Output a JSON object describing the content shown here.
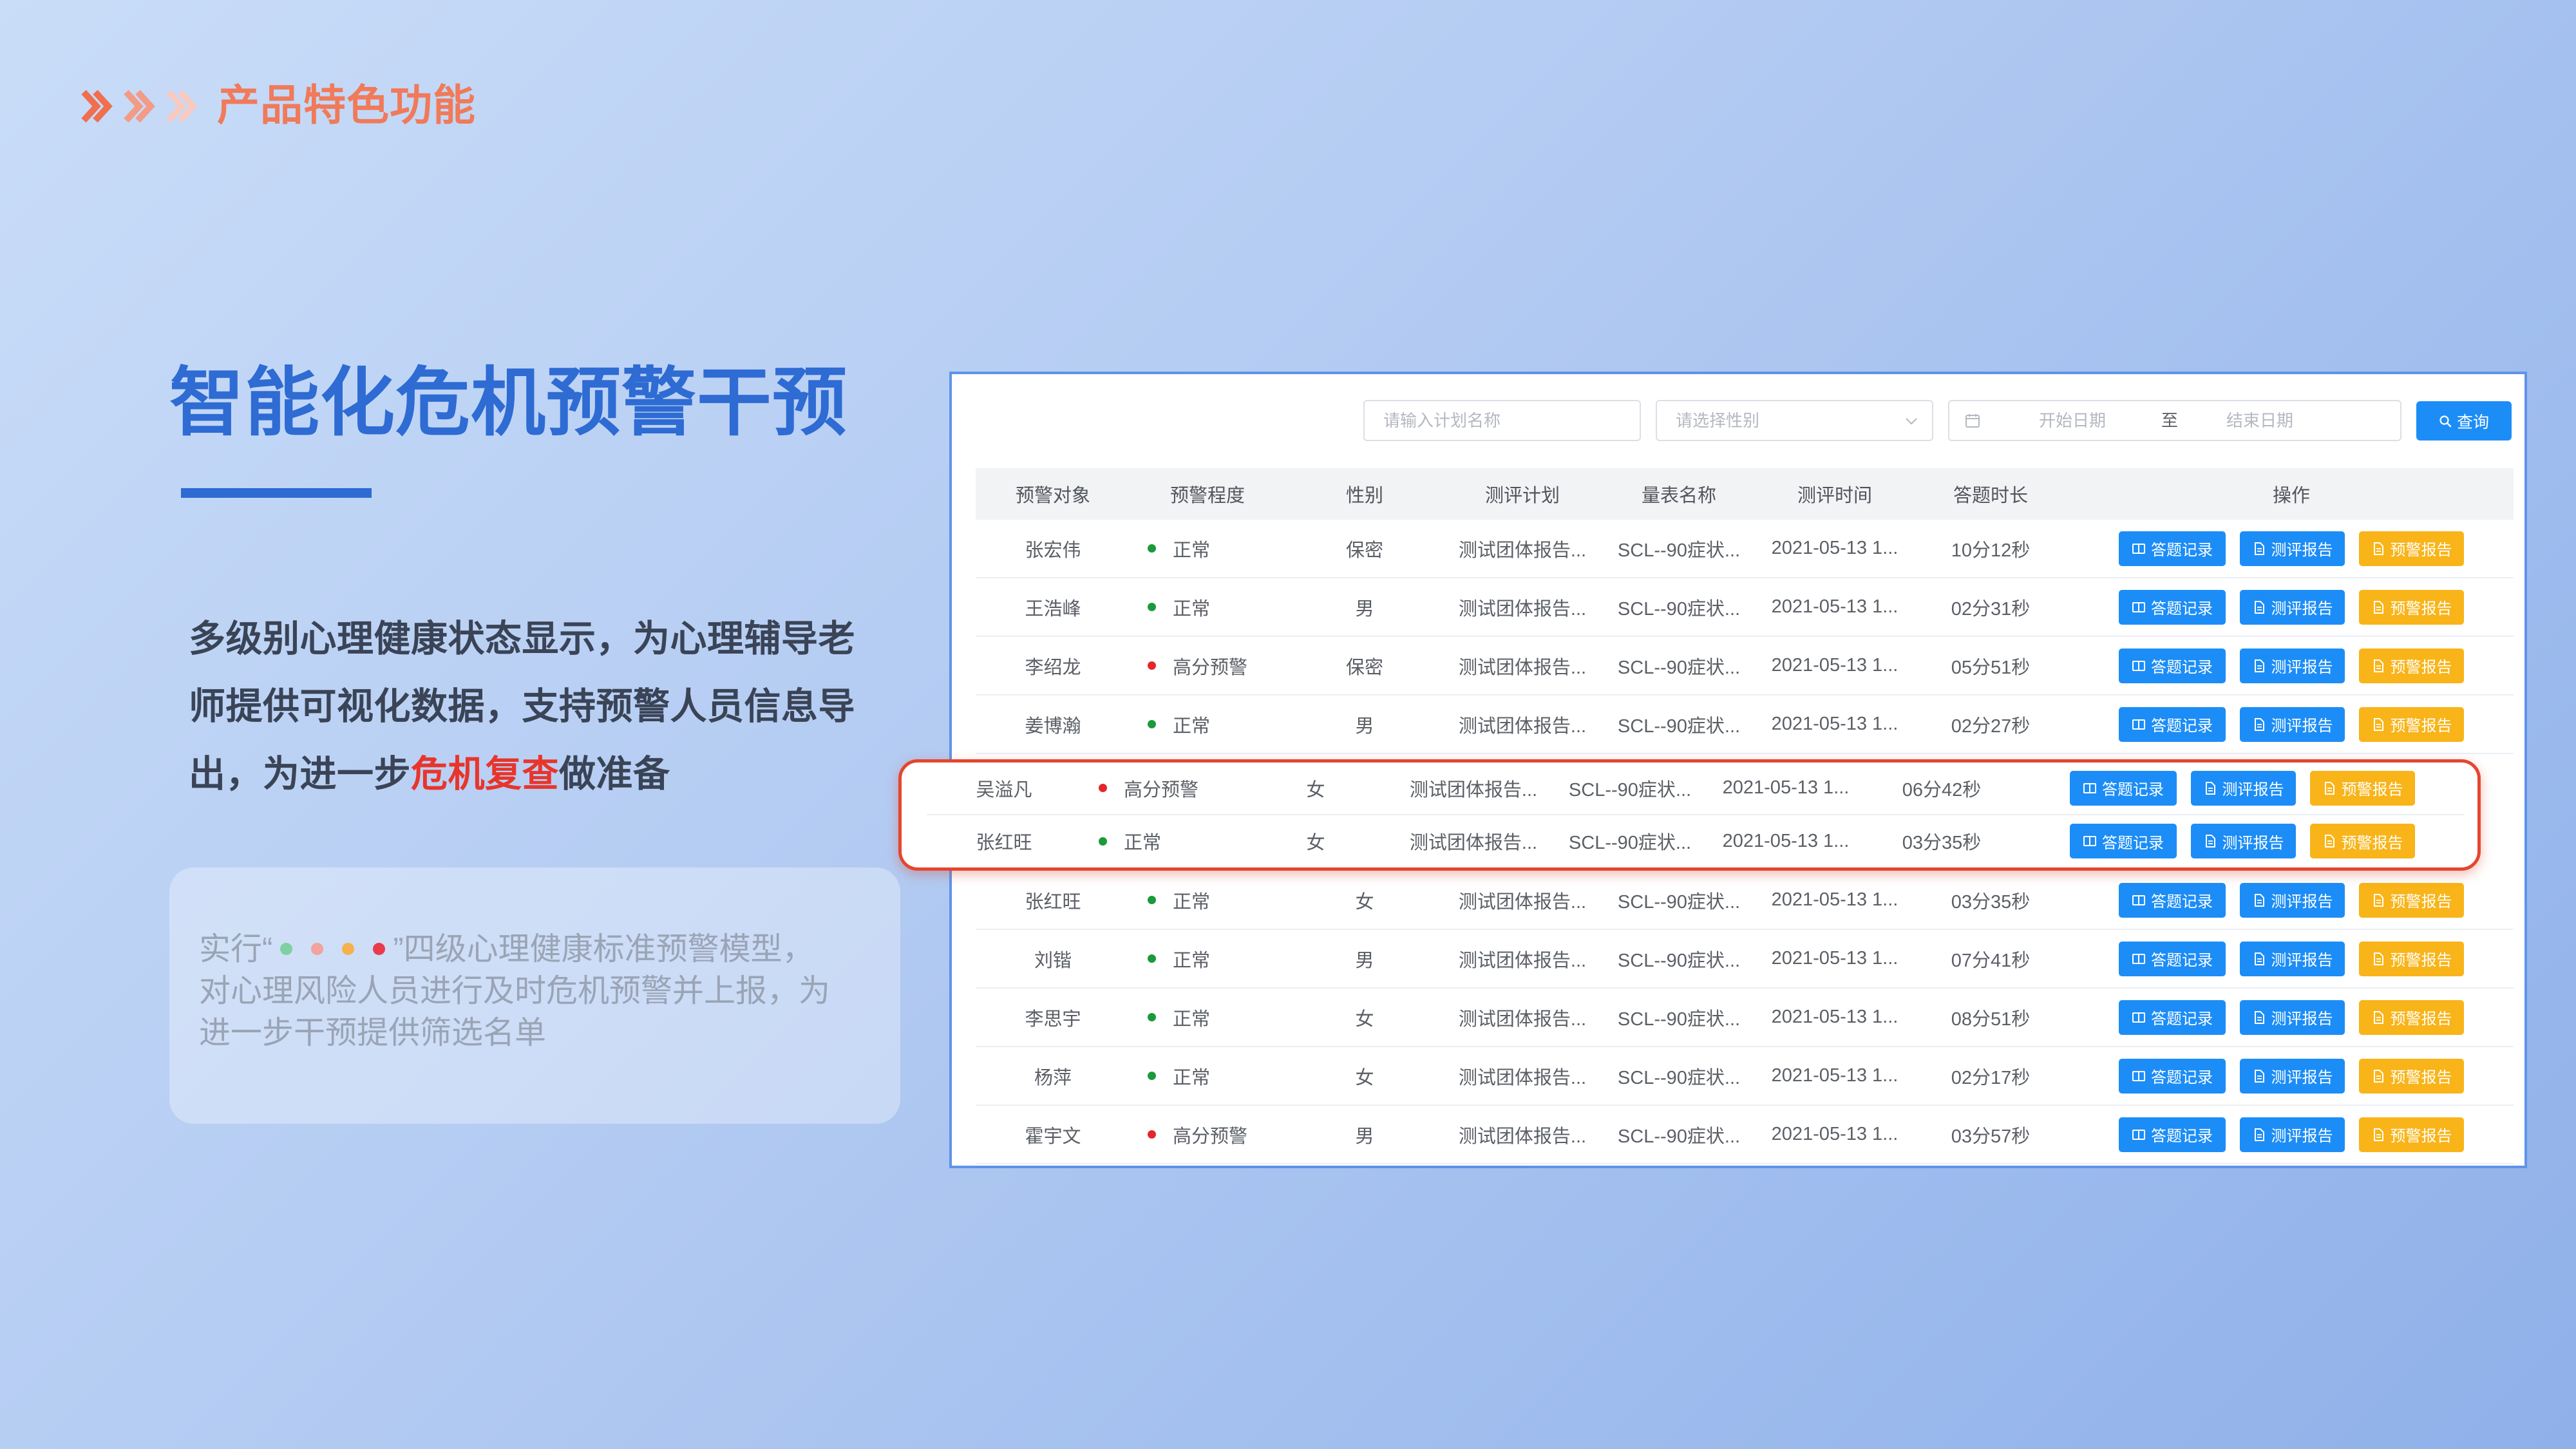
{
  "colors": {
    "accent": "#f07a5a",
    "title": "#2e6bd3",
    "highlight": "#e8352b",
    "primary": "#1c8df7",
    "warning": "#f8b418",
    "alert_border": "#e5462f"
  },
  "slide": {
    "section_title": "产品特色功能",
    "title": "智能化危机预警干预",
    "description": {
      "lines": [
        "多级别心理健康状态显示，为心理辅导老",
        "师提供可视化数据，支持预警人员信息导"
      ],
      "last_line_prefix": "出，为进一步",
      "last_line_highlight": "危机复查",
      "last_line_suffix": "做准备"
    },
    "note": {
      "line1_prefix": "实行“",
      "line1_suffix": "”四级心理健康标准预警模型，",
      "lines": [
        "对心理风险人员进行及时危机预警并上报，为",
        "进一步干预提供筛选名单"
      ],
      "level_colors": [
        "#7fd0a2",
        "#f1a39c",
        "#f5b14c",
        "#e93b4b"
      ]
    }
  },
  "app": {
    "search": {
      "plan_placeholder": "请输入计划名称",
      "gender_placeholder": "请选择性别",
      "start_placeholder": "开始日期",
      "range_separator": "至",
      "end_placeholder": "结束日期",
      "query_label": "查询"
    },
    "columns": [
      "预警对象",
      "预警程度",
      "性别",
      "测评计划",
      "量表名称",
      "测评时间",
      "答题时长",
      "操作"
    ],
    "actions": {
      "answer_record": "答题记录",
      "assessment_report": "测评报告",
      "warning_report": "预警报告"
    },
    "status_colors": {
      "正常": "#1a9a3a",
      "高分预警": "#e5262a"
    },
    "rows_top": [
      {
        "name": "张宏伟",
        "level": "正常",
        "gender": "保密",
        "plan": "测试团体报告...",
        "scale": "SCL--90症状...",
        "time": "2021-05-13 1...",
        "duration": "10分12秒"
      },
      {
        "name": "王浩峰",
        "level": "正常",
        "gender": "男",
        "plan": "测试团体报告...",
        "scale": "SCL--90症状...",
        "time": "2021-05-13 1...",
        "duration": "02分31秒"
      },
      {
        "name": "李绍龙",
        "level": "高分预警",
        "gender": "保密",
        "plan": "测试团体报告...",
        "scale": "SCL--90症状...",
        "time": "2021-05-13 1...",
        "duration": "05分51秒"
      },
      {
        "name": "姜博瀚",
        "level": "正常",
        "gender": "男",
        "plan": "测试团体报告...",
        "scale": "SCL--90症状...",
        "time": "2021-05-13 1...",
        "duration": "02分27秒"
      }
    ],
    "highlight_rows": [
      {
        "name": "吴溢凡",
        "level": "高分预警",
        "gender": "女",
        "plan": "测试团体报告...",
        "scale": "SCL--90症状...",
        "time": "2021-05-13 1...",
        "duration": "06分42秒"
      },
      {
        "name": "张红旺",
        "level": "正常",
        "gender": "女",
        "plan": "测试团体报告...",
        "scale": "SCL--90症状...",
        "time": "2021-05-13 1...",
        "duration": "03分35秒"
      }
    ],
    "rows_bottom": [
      {
        "name": "张红旺",
        "level": "正常",
        "gender": "女",
        "plan": "测试团体报告...",
        "scale": "SCL--90症状...",
        "time": "2021-05-13 1...",
        "duration": "03分35秒"
      },
      {
        "name": "刘锴",
        "level": "正常",
        "gender": "男",
        "plan": "测试团体报告...",
        "scale": "SCL--90症状...",
        "time": "2021-05-13 1...",
        "duration": "07分41秒"
      },
      {
        "name": "李思宇",
        "level": "正常",
        "gender": "女",
        "plan": "测试团体报告...",
        "scale": "SCL--90症状...",
        "time": "2021-05-13 1...",
        "duration": "08分51秒"
      },
      {
        "name": "杨萍",
        "level": "正常",
        "gender": "女",
        "plan": "测试团体报告...",
        "scale": "SCL--90症状...",
        "time": "2021-05-13 1...",
        "duration": "02分17秒"
      },
      {
        "name": "霍宇文",
        "level": "高分预警",
        "gender": "男",
        "plan": "测试团体报告...",
        "scale": "SCL--90症状...",
        "time": "2021-05-13 1...",
        "duration": "03分57秒"
      }
    ]
  }
}
